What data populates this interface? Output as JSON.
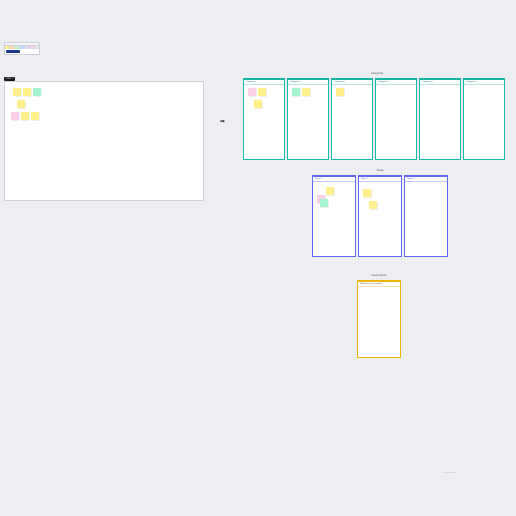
{
  "toolbar": {
    "button": "Add note"
  },
  "step1": {
    "label": "STEP 1"
  },
  "sections": {
    "categories": "Categorías",
    "topics": "Temas",
    "interpretation": "Interpretación"
  },
  "categories": [
    {
      "label": "Categoría 1"
    },
    {
      "label": "Categoría 2"
    },
    {
      "label": "Categoría 3"
    },
    {
      "label": "Categoría 4"
    },
    {
      "label": "Categoría 5"
    },
    {
      "label": "Categoría 6"
    }
  ],
  "topics": [
    {
      "label": "Tema 1"
    },
    {
      "label": "Tema 2"
    },
    {
      "label": "Tema 3"
    }
  ],
  "interp": {
    "label": "Resumen en una oración"
  },
  "footer": "Mural template"
}
